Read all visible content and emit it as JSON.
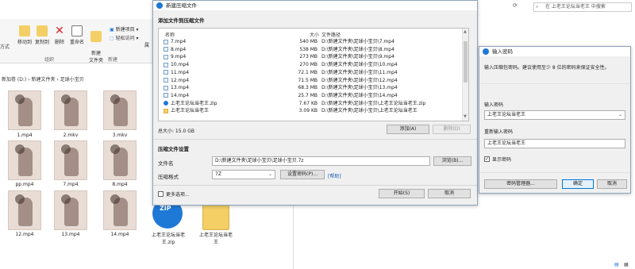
{
  "explorer": {
    "ribbon": {
      "left_cut_label": "方式",
      "move_to": "移动到",
      "copy_to": "复制到",
      "delete": "删除",
      "rename": "重命名",
      "new_folder": "新建\n文件夹",
      "new_item": "新建项目",
      "easy_access": "轻松访问",
      "group_org": "组织",
      "group_new": "新建",
      "truncated": "属"
    },
    "breadcrumb": [
      "新加卷 (D:)",
      "新建文件夹",
      "足球小宝贝"
    ],
    "thumbs": [
      {
        "label": "1.mp4"
      },
      {
        "label": "2.mkv"
      },
      {
        "label": "3.mkv"
      },
      {
        "label": "pp.mp4"
      },
      {
        "label": "7.mp4"
      },
      {
        "label": "8.mp4"
      },
      {
        "label": "12.mp4"
      },
      {
        "label": "13.mp4"
      },
      {
        "label": "14.mp4"
      }
    ],
    "zip_item": {
      "label_line1": "上老王论坛当老",
      "label_line2": "王.zip",
      "badge": "ZIP"
    },
    "folder_item": {
      "label_line1": "上老王论坛当老",
      "label_line2": "王"
    },
    "search_placeholder": "在 上老王论坛当老王 中搜索"
  },
  "dialog": {
    "title": "新建压缩文件",
    "add_section": "添加文件到压缩文件",
    "columns": {
      "name": "名称",
      "size": "大小",
      "path": "文件路径"
    },
    "files": [
      {
        "name": "7.mp4",
        "size": "540 MB",
        "path": "D:\\新建文件夹\\足球小宝贝\\7.mp4"
      },
      {
        "name": "8.mp4",
        "size": "538 MB",
        "path": "D:\\新建文件夹\\足球小宝贝\\8.mp4"
      },
      {
        "name": "9.mp4",
        "size": "273 MB",
        "path": "D:\\新建文件夹\\足球小宝贝\\9.mp4"
      },
      {
        "name": "10.mp4",
        "size": "270 MB",
        "path": "D:\\新建文件夹\\足球小宝贝\\10.mp4"
      },
      {
        "name": "11.mp4",
        "size": "72.1 MB",
        "path": "D:\\新建文件夹\\足球小宝贝\\11.mp4"
      },
      {
        "name": "12.mp4",
        "size": "71.5 MB",
        "path": "D:\\新建文件夹\\足球小宝贝\\12.mp4"
      },
      {
        "name": "13.mp4",
        "size": "68.3 MB",
        "path": "D:\\新建文件夹\\足球小宝贝\\13.mp4"
      },
      {
        "name": "14.mp4",
        "size": "25.7 MB",
        "path": "D:\\新建文件夹\\足球小宝贝\\14.mp4"
      },
      {
        "name": "上老王论坛当老王.zip",
        "size": "7.67 KB",
        "path": "D:\\新建文件夹\\足球小宝贝\\上老王论坛当老王.zip"
      },
      {
        "name": "上老王论坛当老王",
        "size": "3.09 KB",
        "path": "D:\\新建文件夹\\足球小宝贝\\上老王论坛当老王"
      }
    ],
    "total_size": "总大小: 15.0 GB",
    "add_button": "添加(A)",
    "delete_button": "删除(D)",
    "settings_section": "压缩文件设置",
    "filename_label": "文件名",
    "filename_value": "D:\\新建文件夹\\足球小宝贝\\足球小宝贝.7z",
    "browse_button": "浏览(B)...",
    "format_label": "压缩格式",
    "format_value": "7Z",
    "set_password_button": "设置密码(P)...",
    "help_link": "[帮助]",
    "more_options": "更多选项...",
    "start_button": "开始(S)",
    "cancel_button": "取消"
  },
  "password_dialog": {
    "title": "输入密码",
    "instruction": "输入压缩包密码。建议使用至少 8 位的密码来保证安全性。",
    "enter_label": "输入密码",
    "enter_value": "上老王论坛当老王",
    "reenter_label": "重新输入密码",
    "reenter_value": "上老王论坛当老王",
    "show_password": "显示密码",
    "manager_button": "密码管理器...",
    "ok_button": "确定",
    "cancel_button": "取消"
  }
}
